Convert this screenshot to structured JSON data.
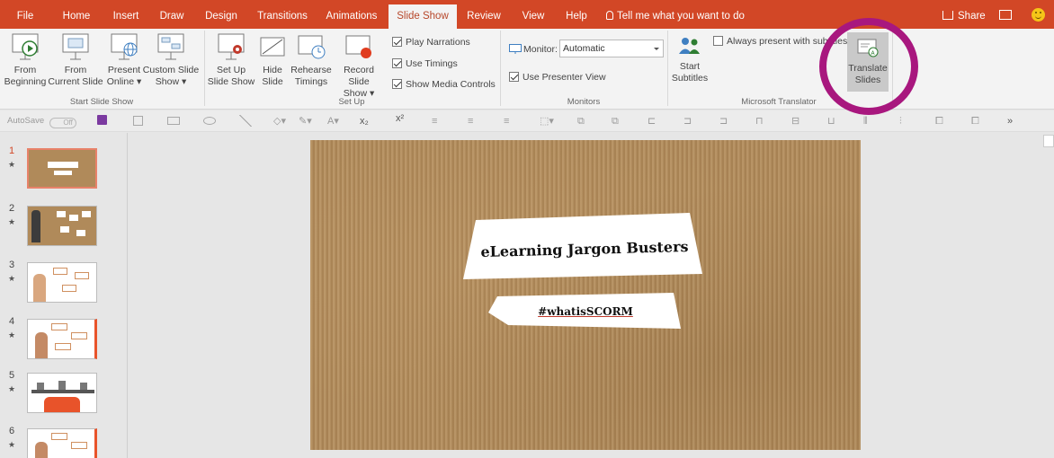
{
  "tabs": [
    {
      "label": "File",
      "active": false
    },
    {
      "label": "Home",
      "active": false
    },
    {
      "label": "Insert",
      "active": false
    },
    {
      "label": "Draw",
      "active": false
    },
    {
      "label": "Design",
      "active": false
    },
    {
      "label": "Transitions",
      "active": false
    },
    {
      "label": "Animations",
      "active": false
    },
    {
      "label": "Slide Show",
      "active": true
    },
    {
      "label": "Review",
      "active": false
    },
    {
      "label": "View",
      "active": false
    },
    {
      "label": "Help",
      "active": false
    }
  ],
  "tell_me": "Tell me what you want to do",
  "share_label": "Share",
  "ribbon": {
    "start_group": {
      "label": "Start Slide Show",
      "from_beginning": [
        "From",
        "Beginning"
      ],
      "from_current": [
        "From",
        "Current Slide"
      ],
      "present_online": [
        "Present",
        "Online ▾"
      ],
      "custom_show": [
        "Custom Slide",
        "Show ▾"
      ]
    },
    "setup_group": {
      "label": "Set Up",
      "setup_show": [
        "Set Up",
        "Slide Show"
      ],
      "hide_slide": [
        "Hide",
        "Slide"
      ],
      "rehearse": [
        "Rehearse",
        "Timings"
      ],
      "record": [
        "Record Slide",
        "Show ▾"
      ],
      "play_narrations": "Play Narrations",
      "use_timings": "Use Timings",
      "show_media_controls": "Show Media Controls"
    },
    "monitors_group": {
      "label": "Monitors",
      "monitor_label": "Monitor:",
      "monitor_value": "Automatic",
      "presenter_view": "Use Presenter View"
    },
    "translator_group": {
      "label": "Microsoft Translator",
      "start_subtitles": [
        "Start",
        "Subtitles"
      ],
      "always_present": "Always present with subtitles",
      "translate_slides": [
        "Translate",
        "Slides"
      ]
    }
  },
  "qat": {
    "autosave": "AutoSave",
    "autosave_state": "Off"
  },
  "thumbnails": [
    {
      "num": "1",
      "selected": true
    },
    {
      "num": "2",
      "selected": false
    },
    {
      "num": "3",
      "selected": false
    },
    {
      "num": "4",
      "selected": false
    },
    {
      "num": "5",
      "selected": false
    },
    {
      "num": "6",
      "selected": false
    }
  ],
  "slide": {
    "title": "eLearning Jargon Busters",
    "subtitle": "#whatisSCORM"
  },
  "colors": {
    "accent": "#d24726",
    "highlight_circle": "#a8177e",
    "cardboard": "#b08a5a"
  }
}
